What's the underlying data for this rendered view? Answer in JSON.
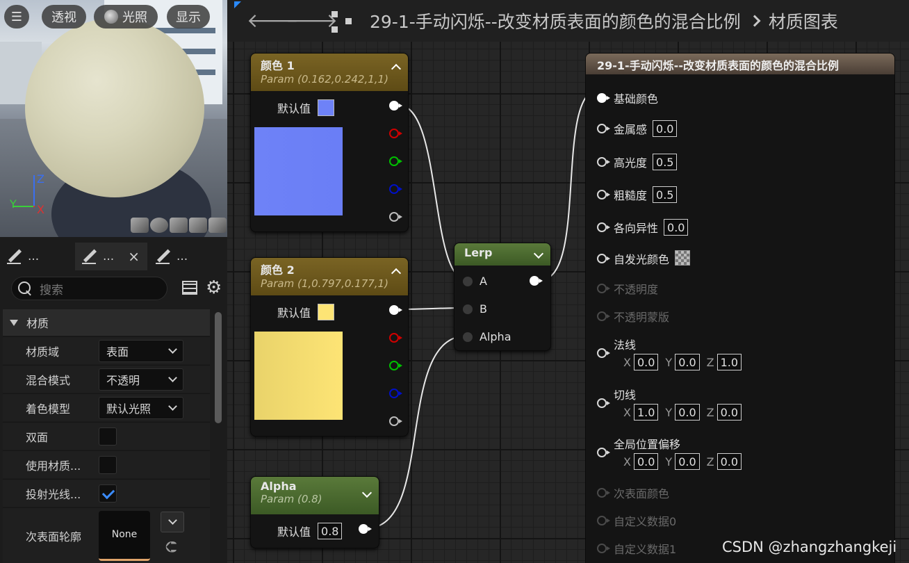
{
  "viewport": {
    "buttons": {
      "perspective": "透视",
      "lighting": "光照",
      "show": "显示"
    },
    "axes": {
      "z": "Z",
      "y": "Y",
      "x": "X"
    }
  },
  "details": {
    "tabs": [
      {
        "label": "...",
        "closable": false
      },
      {
        "label": "...",
        "closable": true,
        "close": "×"
      },
      {
        "label": "...",
        "closable": false
      }
    ],
    "search_placeholder": "搜索",
    "category": "材质",
    "properties": [
      {
        "label": "材质域",
        "type": "combo",
        "value": "表面"
      },
      {
        "label": "混合模式",
        "type": "combo",
        "value": "不透明"
      },
      {
        "label": "着色模型",
        "type": "combo",
        "value": "默认光照"
      },
      {
        "label": "双面",
        "type": "check",
        "checked": false
      },
      {
        "label": "使用材质...",
        "type": "check",
        "checked": false
      },
      {
        "label": "投射光线...",
        "type": "check",
        "checked": true
      },
      {
        "label": "次表面轮廓",
        "type": "asset",
        "value": "None"
      }
    ]
  },
  "toolbar": {
    "crumb_asset": "29-1-手动闪烁--改变材质表面的颜色的混合比例",
    "crumb_graph": "材质图表"
  },
  "nodes": {
    "color1": {
      "title": "颜色 1",
      "subtitle": "Param (0.162,0.242,1,1)",
      "default_label": "默认值",
      "color": "#6e82f7"
    },
    "color2": {
      "title": "颜色 2",
      "subtitle": "Param (1,0.797,0.177,1)",
      "default_label": "默认值",
      "color": "#fde475"
    },
    "alpha": {
      "title": "Alpha",
      "subtitle": "Param (0.8)",
      "default_label": "默认值",
      "value": "0.8"
    },
    "lerp": {
      "title": "Lerp",
      "inputs": [
        "A",
        "B",
        "Alpha"
      ]
    },
    "result": {
      "title": "29-1-手动闪烁--改变材质表面的颜色的混合比例",
      "pins": [
        {
          "label": "基础颜色",
          "state": "connected"
        },
        {
          "label": "金属感",
          "state": "active",
          "value": "0.0"
        },
        {
          "label": "高光度",
          "state": "active",
          "value": "0.5"
        },
        {
          "label": "粗糙度",
          "state": "active",
          "value": "0.5"
        },
        {
          "label": "各向异性",
          "state": "active",
          "value": "0.0"
        },
        {
          "label": "自发光颜色",
          "state": "active",
          "swatch": "checker"
        },
        {
          "label": "不透明度",
          "state": "disabled"
        },
        {
          "label": "不透明蒙版",
          "state": "disabled"
        },
        {
          "label": "法线",
          "state": "active",
          "vec": {
            "x": "0.0",
            "y": "0.0",
            "z": "1.0"
          }
        },
        {
          "label": "切线",
          "state": "active",
          "vec": {
            "x": "1.0",
            "y": "0.0",
            "z": "0.0"
          }
        },
        {
          "label": "全局位置偏移",
          "state": "active",
          "vec": {
            "x": "0.0",
            "y": "0.0",
            "z": "0.0"
          }
        },
        {
          "label": "次表面颜色",
          "state": "disabled"
        },
        {
          "label": "自定义数据0",
          "state": "disabled"
        },
        {
          "label": "自定义数据1",
          "state": "disabled"
        }
      ],
      "vec_labels": {
        "x": "X",
        "y": "Y",
        "z": "Z"
      }
    }
  },
  "watermark": "CSDN @zhangzhangkeji"
}
